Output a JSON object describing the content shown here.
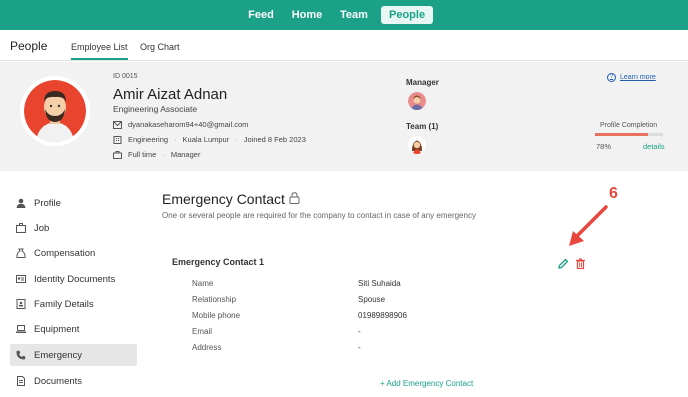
{
  "topnav": {
    "items": [
      {
        "label": "Feed",
        "active": false
      },
      {
        "label": "Home",
        "active": false
      },
      {
        "label": "Team",
        "active": false
      },
      {
        "label": "People",
        "active": true
      }
    ]
  },
  "subheader": {
    "title": "People",
    "tabs": [
      {
        "label": "Employee List",
        "active": true
      },
      {
        "label": "Org Chart",
        "active": false
      }
    ]
  },
  "profile": {
    "id": "ID 0015",
    "name": "Amir Aizat Adnan",
    "job_title": "Engineering Associate",
    "email": "dyanakaseharom94+40@gmail.com",
    "department": "Engineering",
    "location": "Kuala Lumpur",
    "joined": "Joined 8 Feb 2023",
    "employment_type": "Full time",
    "role": "Manager",
    "separator": "·",
    "manager_label": "Manager",
    "team_label": "Team (1)",
    "learn_more": "Learn more",
    "learn_more_icon_glyph": "?",
    "completion_label": "Profile Completion",
    "completion_percent": 78,
    "completion_text": "78%",
    "details_link": "details"
  },
  "sidebar": {
    "items": [
      {
        "label": "Profile",
        "icon": "person-icon",
        "active": false
      },
      {
        "label": "Job",
        "icon": "briefcase-icon",
        "active": false
      },
      {
        "label": "Compensation",
        "icon": "money-bag-icon",
        "active": false
      },
      {
        "label": "Identity Documents",
        "icon": "id-card-icon",
        "active": false
      },
      {
        "label": "Family Details",
        "icon": "family-icon",
        "active": false
      },
      {
        "label": "Equipment",
        "icon": "laptop-icon",
        "active": false
      },
      {
        "label": "Emergency",
        "icon": "phone-icon",
        "active": true
      },
      {
        "label": "Documents",
        "icon": "document-icon",
        "active": false
      }
    ]
  },
  "main": {
    "title": "Emergency Contact",
    "subtitle": "One or several people are required for the company to contact in case of any emergency",
    "contact_title": "Emergency Contact 1",
    "fields": [
      {
        "label": "Name",
        "value": "Siti Suhaida"
      },
      {
        "label": "Relationship",
        "value": "Spouse"
      },
      {
        "label": "Mobile phone",
        "value": "01989898906"
      },
      {
        "label": "Email",
        "value": "-"
      },
      {
        "label": "Address",
        "value": "-"
      }
    ],
    "add_contact": "+ Add Emergency Contact"
  },
  "annotation": {
    "number": "6"
  },
  "colors": {
    "brand": "#1aa187",
    "annotation": "#e8473d",
    "progress": "#e87060",
    "link": "#1f5fb0"
  }
}
